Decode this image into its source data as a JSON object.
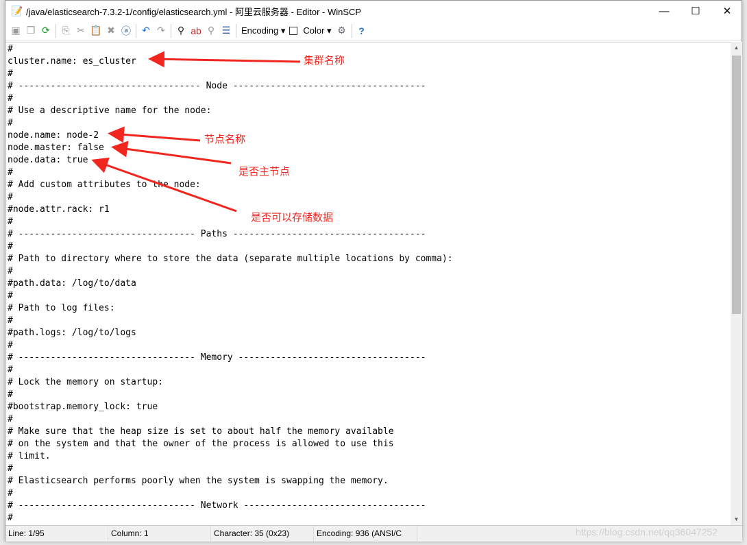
{
  "window": {
    "title": "/java/elasticsearch-7.3.2-1/config/elasticsearch.yml - 阿里云服务器 - Editor - WinSCP",
    "controls": [
      "—",
      "☐",
      "✕"
    ]
  },
  "toolbar": {
    "encoding_label": "Encoding",
    "color_label": "Color",
    "icons": [
      "save-icon",
      "save-all-icon",
      "reload-icon",
      "copy-icon",
      "cut-icon",
      "paste-icon",
      "delete-icon",
      "select-all-icon",
      "undo-icon",
      "redo-icon",
      "find-icon",
      "replace-icon",
      "find-next-icon",
      "goto-line-icon",
      "preferences-icon",
      "help-icon"
    ]
  },
  "editor": {
    "lines": [
      "#",
      "cluster.name: es_cluster",
      "#",
      "# ---------------------------------- Node ------------------------------------",
      "#",
      "# Use a descriptive name for the node:",
      "#",
      "node.name: node-2",
      "node.master: false",
      "node.data: true",
      "#",
      "# Add custom attributes to the node:",
      "#",
      "#node.attr.rack: r1",
      "#",
      "# --------------------------------- Paths ------------------------------------",
      "#",
      "# Path to directory where to store the data (separate multiple locations by comma):",
      "#",
      "#path.data: /log/to/data",
      "#",
      "# Path to log files:",
      "#",
      "#path.logs: /log/to/logs",
      "#",
      "# --------------------------------- Memory -----------------------------------",
      "#",
      "# Lock the memory on startup:",
      "#",
      "#bootstrap.memory_lock: true",
      "#",
      "# Make sure that the heap size is set to about half the memory available",
      "# on the system and that the owner of the process is allowed to use this",
      "# limit.",
      "#",
      "# Elasticsearch performs poorly when the system is swapping the memory.",
      "#",
      "# --------------------------------- Network ----------------------------------",
      "#"
    ]
  },
  "annotations": {
    "cluster_name": "集群名称",
    "node_name": "节点名称",
    "node_master": "是否主节点",
    "node_data": "是否可以存储数据",
    "color": "#f0261f"
  },
  "status": {
    "line": "Line: 1/95",
    "column": "Column: 1",
    "character": "Character: 35 (0x23)",
    "encoding": "Encoding: 936   (ANSI/C"
  },
  "watermark": "https://blog.csdn.net/qq36047252"
}
